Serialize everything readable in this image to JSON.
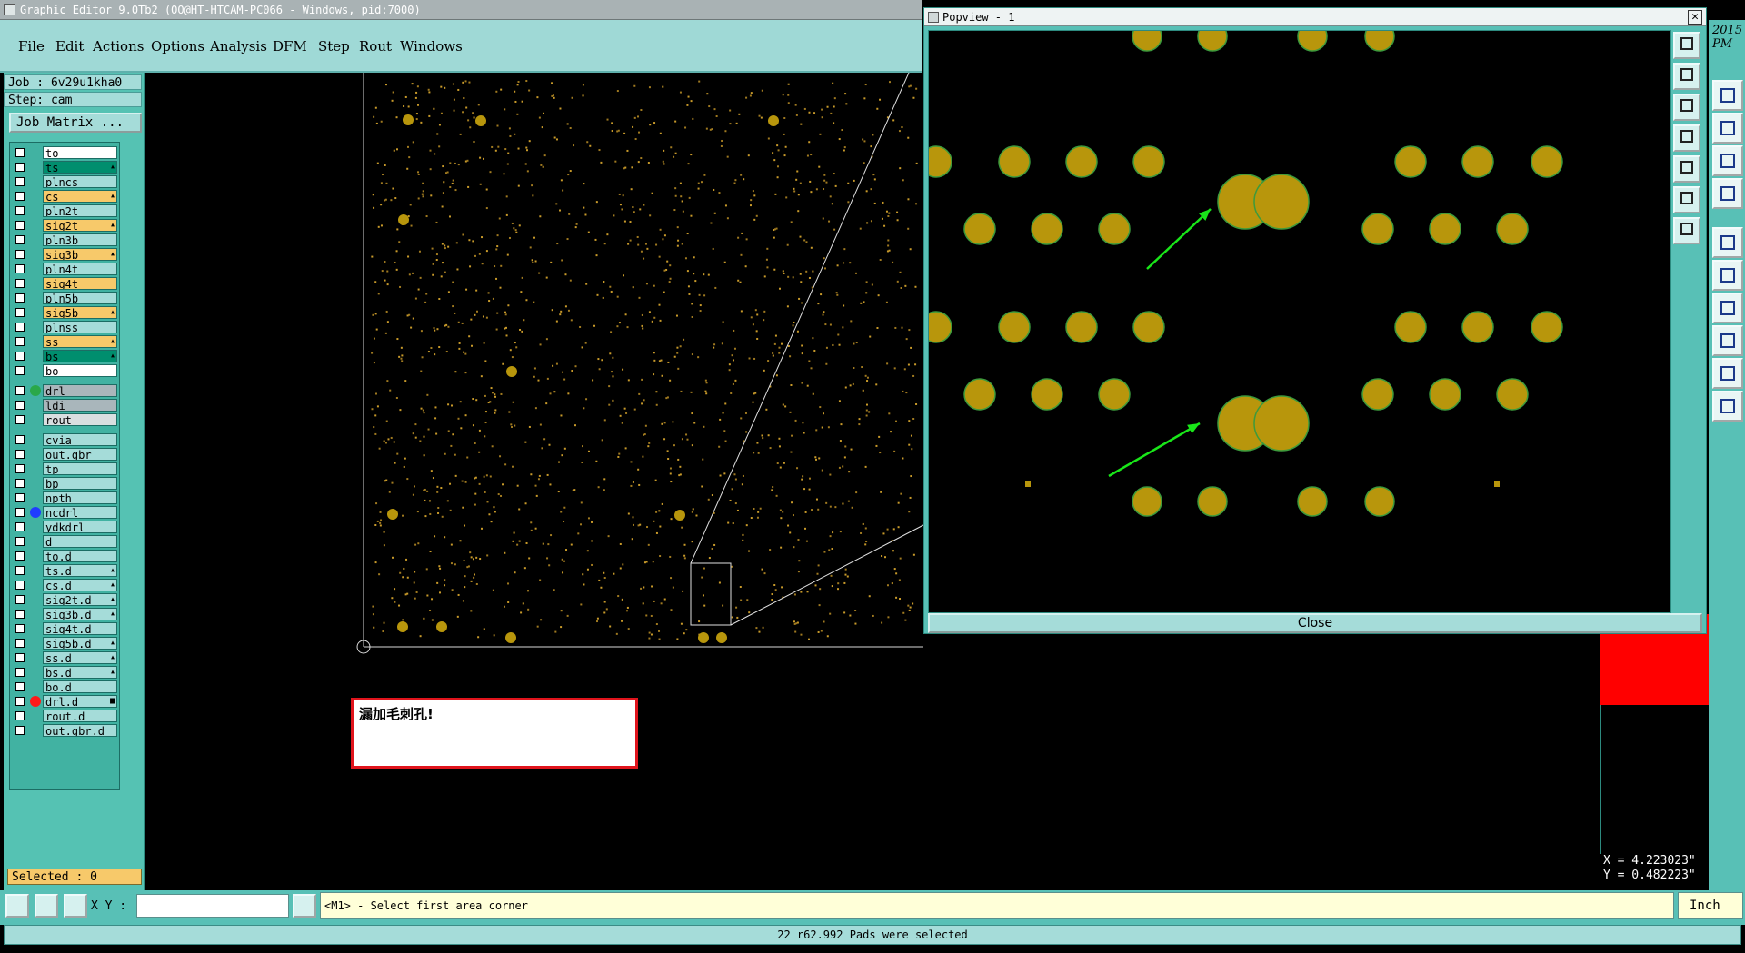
{
  "window": {
    "title": "Graphic Editor 9.0Tb2 (OO@HT-HTCAM-PC066 - Windows, pid:7000)"
  },
  "menu": {
    "items": [
      "File",
      "Edit",
      "Actions",
      "Options",
      "Analysis",
      "DFM",
      "Step",
      "Rout",
      "Windows"
    ]
  },
  "job": {
    "job_line": "Job : 6v29u1kha0",
    "step_line": "Step: cam",
    "matrix_button": "Job Matrix ..."
  },
  "layers": [
    {
      "name": "to",
      "bg": "#ffffff",
      "dot": "",
      "flag": ""
    },
    {
      "name": "ts",
      "bg": "#008e6e",
      "dot": "",
      "flag": "▴"
    },
    {
      "name": "plncs",
      "bg": "#a5dcd9",
      "dot": "",
      "flag": ""
    },
    {
      "name": "cs",
      "bg": "#f7c96a",
      "dot": "",
      "flag": "▴"
    },
    {
      "name": "pln2t",
      "bg": "#a5dcd9",
      "dot": "",
      "flag": ""
    },
    {
      "name": "sig2t",
      "bg": "#f7c96a",
      "dot": "",
      "flag": "▴"
    },
    {
      "name": "pln3b",
      "bg": "#a5dcd9",
      "dot": "",
      "flag": ""
    },
    {
      "name": "sig3b",
      "bg": "#f7c96a",
      "dot": "",
      "flag": "▴"
    },
    {
      "name": "pln4t",
      "bg": "#a5dcd9",
      "dot": "",
      "flag": ""
    },
    {
      "name": "sig4t",
      "bg": "#f7c96a",
      "dot": "",
      "flag": ""
    },
    {
      "name": "pln5b",
      "bg": "#a5dcd9",
      "dot": "",
      "flag": ""
    },
    {
      "name": "sig5b",
      "bg": "#f7c96a",
      "dot": "",
      "flag": "▴"
    },
    {
      "name": "plnss",
      "bg": "#a5dcd9",
      "dot": "",
      "flag": ""
    },
    {
      "name": "ss",
      "bg": "#f7c96a",
      "dot": "",
      "flag": "▴"
    },
    {
      "name": "bs",
      "bg": "#008e6e",
      "dot": "",
      "flag": "▴"
    },
    {
      "name": "bo",
      "bg": "#ffffff",
      "dot": "",
      "flag": ""
    },
    {
      "name": "drl",
      "bg": "#a9b6bb",
      "dot": "#2aa84a",
      "flag": ""
    },
    {
      "name": "ldi",
      "bg": "#a9b6bb",
      "dot": "",
      "flag": ""
    },
    {
      "name": "rout",
      "bg": "#d9dfe0",
      "dot": "",
      "flag": ""
    },
    {
      "name": "cvia",
      "bg": "#a5dcd9",
      "dot": "",
      "flag": ""
    },
    {
      "name": "out.gbr",
      "bg": "#a5dcd9",
      "dot": "",
      "flag": ""
    },
    {
      "name": "tp",
      "bg": "#a5dcd9",
      "dot": "",
      "flag": ""
    },
    {
      "name": "bp",
      "bg": "#a5dcd9",
      "dot": "",
      "flag": ""
    },
    {
      "name": "npth",
      "bg": "#a5dcd9",
      "dot": "",
      "flag": ""
    },
    {
      "name": "ncdrl",
      "bg": "#a5dcd9",
      "dot": "#1f3cff",
      "flag": ""
    },
    {
      "name": "ydkdrl",
      "bg": "#a5dcd9",
      "dot": "",
      "flag": ""
    },
    {
      "name": "d",
      "bg": "#a5dcd9",
      "dot": "",
      "flag": ""
    },
    {
      "name": "to.d",
      "bg": "#a5dcd9",
      "dot": "",
      "flag": ""
    },
    {
      "name": "ts.d",
      "bg": "#a5dcd9",
      "dot": "",
      "flag": "▴"
    },
    {
      "name": "cs.d",
      "bg": "#a5dcd9",
      "dot": "",
      "flag": "▴"
    },
    {
      "name": "sig2t.d",
      "bg": "#a5dcd9",
      "dot": "",
      "flag": "▴"
    },
    {
      "name": "sig3b.d",
      "bg": "#a5dcd9",
      "dot": "",
      "flag": "▴"
    },
    {
      "name": "sig4t.d",
      "bg": "#a5dcd9",
      "dot": "",
      "flag": ""
    },
    {
      "name": "sig5b.d",
      "bg": "#a5dcd9",
      "dot": "",
      "flag": "▴"
    },
    {
      "name": "ss.d",
      "bg": "#a5dcd9",
      "dot": "",
      "flag": "▴"
    },
    {
      "name": "bs.d",
      "bg": "#a5dcd9",
      "dot": "",
      "flag": "▴"
    },
    {
      "name": "bo.d",
      "bg": "#a5dcd9",
      "dot": "",
      "flag": ""
    },
    {
      "name": "drl.d",
      "bg": "#a5dcd9",
      "dot": "#ff1a1a",
      "flag": "■"
    },
    {
      "name": "rout.d",
      "bg": "#a5dcd9",
      "dot": "",
      "flag": ""
    },
    {
      "name": "out.gbr.d",
      "bg": "#a5dcd9",
      "dot": "",
      "flag": ""
    }
  ],
  "selected": "Selected : 0",
  "popup": {
    "title": "Popview - 1",
    "close_label": "Close"
  },
  "clock": {
    "line1": "2015",
    "line2": "PM"
  },
  "message": "漏加毛刺孔!",
  "coords": {
    "x": "X = 4.223023\"",
    "y": "Y = 0.482223\""
  },
  "command": {
    "xy_label": "X Y :",
    "prompt": "<M1> - Select first area corner",
    "units": "Inch"
  },
  "status": "22 r62.992 Pads were selected",
  "colors": {
    "pad": "#b8960c",
    "pad_outline": "#3c9a3c",
    "arrow": "#19e619",
    "panel": "#58c0b6"
  }
}
